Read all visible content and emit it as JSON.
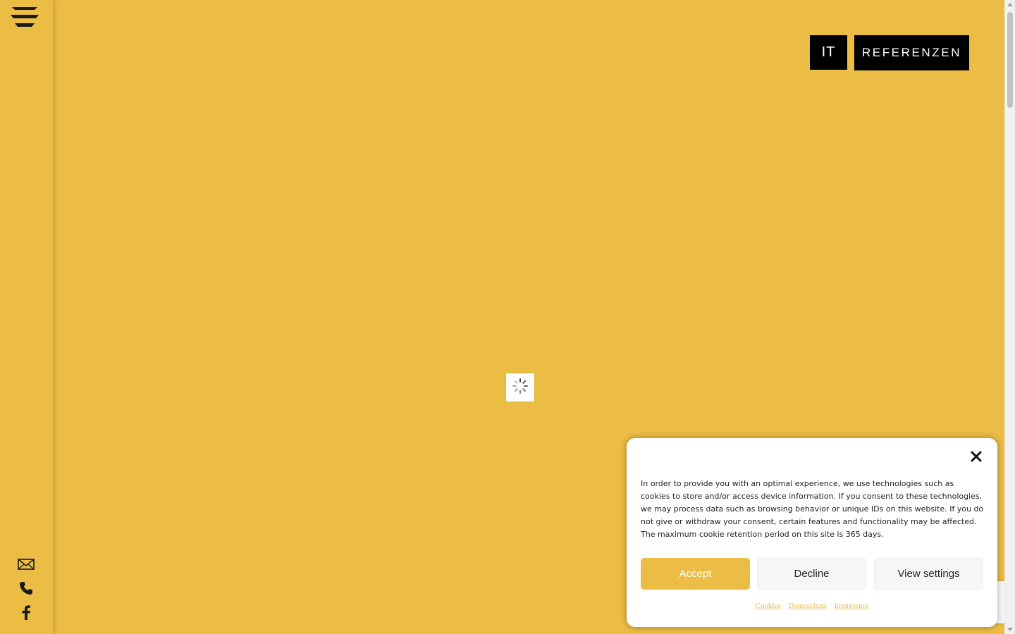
{
  "colors": {
    "background": "#ecbd45",
    "accent": "#ecbd45",
    "dark": "#000000",
    "text": "#222222"
  },
  "sidebar": {
    "menu_icon": "hamburger-menu-icon",
    "icons": [
      "mail-icon",
      "phone-icon",
      "facebook-icon"
    ]
  },
  "header": {
    "lang_label": "IT",
    "references_label": "REFERENZEN"
  },
  "loader": {
    "icon": "spinner-icon"
  },
  "cookie_banner": {
    "text": "In order to provide you with an optimal experience, we use technologies such as cookies to store and/or access device information. If you consent to these technologies, we may process data such as browsing behavior or unique IDs on this website. If you do not give or withdraw your consent, certain features and functionality may be affected. The maximum cookie retention period on this site is 365 days.",
    "accept_label": "Accept",
    "decline_label": "Decline",
    "view_settings_label": "View settings",
    "links": [
      "Cookies",
      "Datenschutz",
      "Impressum"
    ],
    "close_icon": "close-icon"
  }
}
